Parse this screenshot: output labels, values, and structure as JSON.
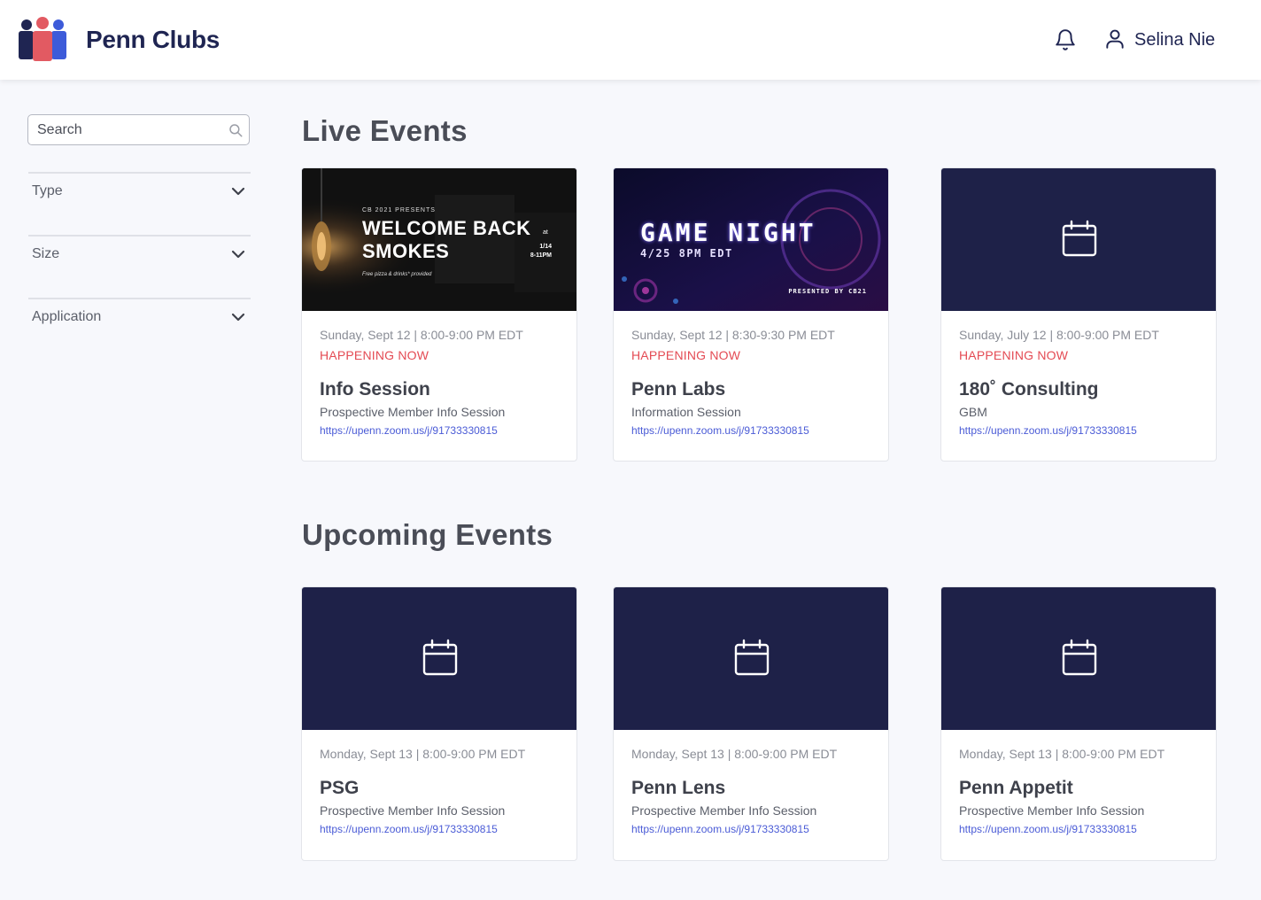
{
  "header": {
    "app_title": "Penn Clubs",
    "user_name": "Selina Nie",
    "logo_icon": "people-group-logo",
    "notification_icon": "bell-icon",
    "user_icon": "user-icon"
  },
  "sidebar": {
    "search_placeholder": "Search",
    "filters": [
      {
        "label": "Type"
      },
      {
        "label": "Size"
      },
      {
        "label": "Application"
      }
    ]
  },
  "live_events": {
    "title": "Live Events",
    "cards": [
      {
        "image": {
          "kind": "promo-welcome-back",
          "kicker": "CB 2021 PRESENTS",
          "line1": "WELCOME BACK",
          "at": "at",
          "line2": "SMOKES",
          "date": "1/14",
          "time": "8-11PM",
          "note": "Free pizza & drinks* provided"
        },
        "date": "Sunday, Sept 12 | 8:00-9:00 PM EDT",
        "status": "HAPPENING NOW",
        "name": "Info Session",
        "description": "Prospective Member Info Session",
        "link": "https://upenn.zoom.us/j/91733330815"
      },
      {
        "image": {
          "kind": "promo-game-night",
          "line1": "GAME NIGHT",
          "line2": "4/25 8PM EDT",
          "footer": "PRESENTED BY CB21"
        },
        "date": "Sunday, Sept 12 | 8:30-9:30 PM EDT",
        "status": "HAPPENING NOW",
        "name": "Penn Labs",
        "description": "Information Session",
        "link": "https://upenn.zoom.us/j/91733330815"
      },
      {
        "image": {
          "kind": "calendar-placeholder"
        },
        "date": "Sunday, July 12 | 8:00-9:00 PM EDT",
        "status": "HAPPENING NOW",
        "name": "180˚ Consulting",
        "description": "GBM",
        "link": "https://upenn.zoom.us/j/91733330815"
      }
    ]
  },
  "upcoming_events": {
    "title": "Upcoming Events",
    "cards": [
      {
        "image": {
          "kind": "calendar-placeholder"
        },
        "date": "Monday, Sept 13 | 8:00-9:00 PM EDT",
        "name": "PSG",
        "description": "Prospective Member Info Session",
        "link": "https://upenn.zoom.us/j/91733330815"
      },
      {
        "image": {
          "kind": "calendar-placeholder"
        },
        "date": "Monday, Sept 13 | 8:00-9:00 PM EDT",
        "name": "Penn Lens",
        "description": "Prospective Member Info Session",
        "link": "https://upenn.zoom.us/j/91733330815"
      },
      {
        "image": {
          "kind": "calendar-placeholder"
        },
        "date": "Monday, Sept 13 | 8:00-9:00 PM EDT",
        "name": "Penn Appetit",
        "description": "Prospective Member Info Session",
        "link": "https://upenn.zoom.us/j/91733330815"
      }
    ]
  },
  "colors": {
    "brand_navy": "#1f2552",
    "card_image_bg": "#1e2148",
    "live_status": "#e44b54",
    "link": "#4a5bd6",
    "selected_outline": "#4a78e8"
  }
}
